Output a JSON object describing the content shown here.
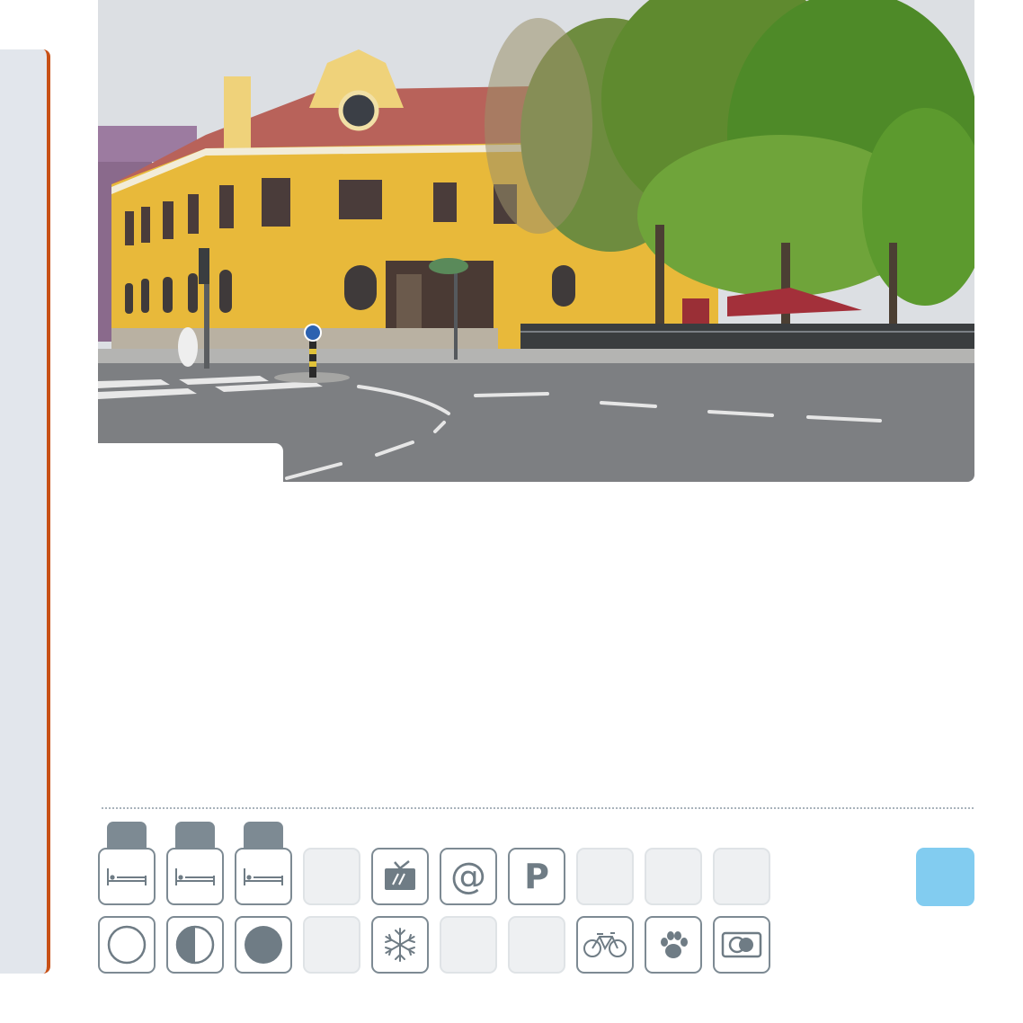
{
  "photo": {
    "subject": "yellow-corner-building-with-trees-and-street"
  },
  "colors": {
    "side_panel": "#e2e6ec",
    "side_border": "#c85016",
    "icon_stroke": "#7d8a93",
    "inactive_tile": "#eef0f2",
    "accent_tile": "#82ccf0"
  },
  "amenities": {
    "row1": [
      {
        "icon": "bed-icon",
        "active": true
      },
      {
        "icon": "bed-icon",
        "active": true
      },
      {
        "icon": "bed-icon",
        "active": true
      },
      {
        "icon": "empty",
        "active": false
      },
      {
        "icon": "tv-icon",
        "active": true
      },
      {
        "icon": "at-sign-icon",
        "active": true,
        "glyph": "@"
      },
      {
        "icon": "parking-icon",
        "active": true,
        "glyph": "P"
      },
      {
        "icon": "empty",
        "active": false
      },
      {
        "icon": "empty",
        "active": false
      },
      {
        "icon": "empty",
        "active": false
      }
    ],
    "row2": [
      {
        "icon": "circle-empty-icon",
        "active": true
      },
      {
        "icon": "circle-half-icon",
        "active": true
      },
      {
        "icon": "circle-full-icon",
        "active": true
      },
      {
        "icon": "empty",
        "active": false
      },
      {
        "icon": "snowflake-icon",
        "active": true
      },
      {
        "icon": "empty",
        "active": false
      },
      {
        "icon": "empty",
        "active": false
      },
      {
        "icon": "bicycle-icon",
        "active": true
      },
      {
        "icon": "paw-icon",
        "active": true
      },
      {
        "icon": "credit-card-icon",
        "active": true
      }
    ]
  }
}
